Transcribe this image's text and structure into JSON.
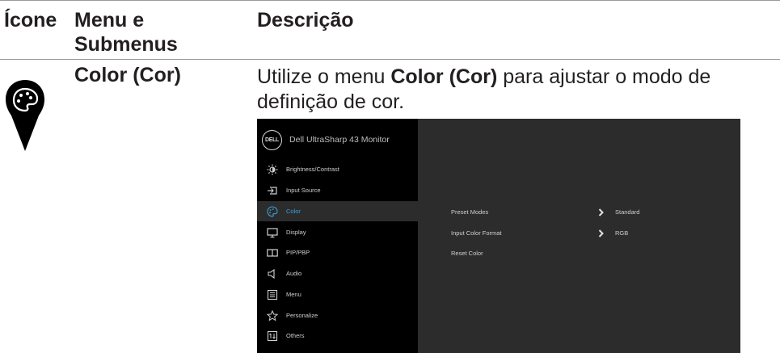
{
  "header": {
    "col_icon": "Ícone",
    "col_menu_line1": "Menu e",
    "col_menu_line2": "Submenus",
    "col_desc": "Descrição"
  },
  "row": {
    "icon": "color-palette-pin-icon",
    "menu_name": "Color (Cor)",
    "desc_before": "Utilize o menu ",
    "desc_bold": "Color (Cor)",
    "desc_after": " para ajustar o modo de",
    "desc_line2": "definição de cor."
  },
  "osd": {
    "title": "Dell UltraSharp 43 Monitor",
    "logo": "DELL",
    "menu": [
      {
        "label": "Brightness/Contrast",
        "icon": "brightness-icon",
        "active": false
      },
      {
        "label": "Input Source",
        "icon": "input-source-icon",
        "active": false
      },
      {
        "label": "Color",
        "icon": "color-icon",
        "active": true
      },
      {
        "label": "Display",
        "icon": "display-icon",
        "active": false
      },
      {
        "label": "PIP/PBP",
        "icon": "pip-pbp-icon",
        "active": false
      },
      {
        "label": "Audio",
        "icon": "audio-icon",
        "active": false
      },
      {
        "label": "Menu",
        "icon": "menu-icon",
        "active": false
      },
      {
        "label": "Personalize",
        "icon": "star-icon",
        "active": false
      },
      {
        "label": "Others",
        "icon": "others-icon",
        "active": false
      }
    ],
    "submenu": [
      {
        "label": "Preset Modes",
        "value": "Standard",
        "has_arrow": true
      },
      {
        "label": "Input Color Format",
        "value": "RGB",
        "has_arrow": true
      },
      {
        "label": "Reset Color",
        "value": "",
        "has_arrow": false
      }
    ],
    "colors": {
      "accent": "#3aa0dc",
      "panel": "#2c2c2c",
      "sidebar": "#000000"
    }
  }
}
